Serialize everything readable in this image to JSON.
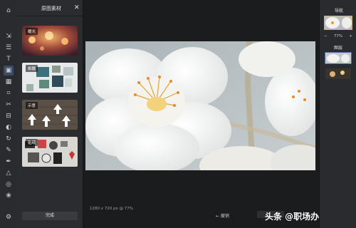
{
  "toolbar": {
    "tools": [
      "home-icon",
      "move-icon",
      "layers-icon",
      "text-icon",
      "image-icon",
      "photo-icon",
      "crop-icon",
      "scissors-icon",
      "adjust-icon",
      "circle-icon",
      "rotate-icon",
      "brush-icon",
      "pen-icon",
      "triangle-icon",
      "globe-icon",
      "filter-icon",
      "settings-icon"
    ]
  },
  "panel": {
    "title": "原图素材",
    "close": "✕",
    "thumbnails": [
      {
        "tag": "暖光",
        "name": "warm-lights"
      },
      {
        "tag": "拍摄",
        "name": "gallery-wall"
      },
      {
        "tag": "示意",
        "name": "arrows-wood"
      },
      {
        "tag": "贴纸",
        "name": "stickers-collage"
      }
    ],
    "bottom_button": "完成"
  },
  "canvas": {
    "status": "1280 x 720 px @ 77%",
    "undo": "← 撤销"
  },
  "nav": {
    "title": "导航",
    "zoom_minus": "−",
    "zoom_value": "77%",
    "zoom_plus": "+",
    "layers_title": "图层"
  },
  "watermark": "头条 @职场办公技能",
  "colors": {
    "accent": "#3c4b63",
    "panel_bg": "#2b2c2f",
    "canvas_bg": "#1b1c1e"
  }
}
